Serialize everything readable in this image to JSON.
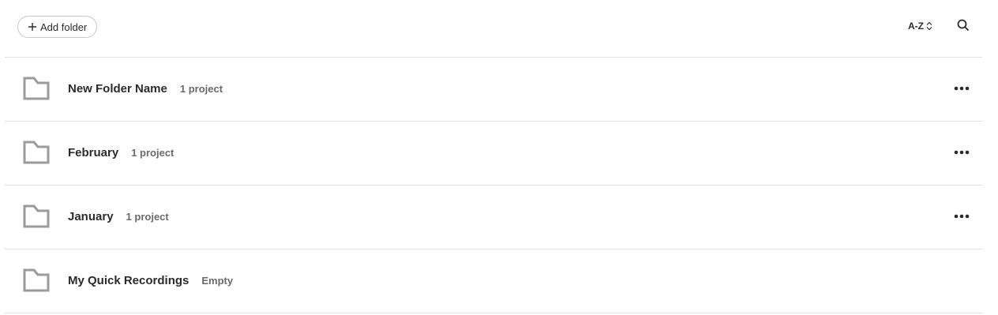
{
  "toolbar": {
    "add_folder_label": "Add folder",
    "sort_label": "A-Z"
  },
  "folders": [
    {
      "name": "New Folder Name",
      "meta": "1 project",
      "has_menu": true
    },
    {
      "name": "February",
      "meta": "1 project",
      "has_menu": true
    },
    {
      "name": "January",
      "meta": "1 project",
      "has_menu": true
    },
    {
      "name": "My Quick Recordings",
      "meta": "Empty",
      "has_menu": false
    }
  ],
  "icons": {
    "add": "plus-icon",
    "sort": "sort-chevrons-icon",
    "search": "search-icon",
    "folder": "folder-icon",
    "more": "more-horizontal-icon"
  },
  "colors": {
    "folder_stroke": "#9b9b9b",
    "text": "#2b2b2b",
    "meta_text": "#6a6a6a",
    "divider": "#e2e2e2"
  }
}
